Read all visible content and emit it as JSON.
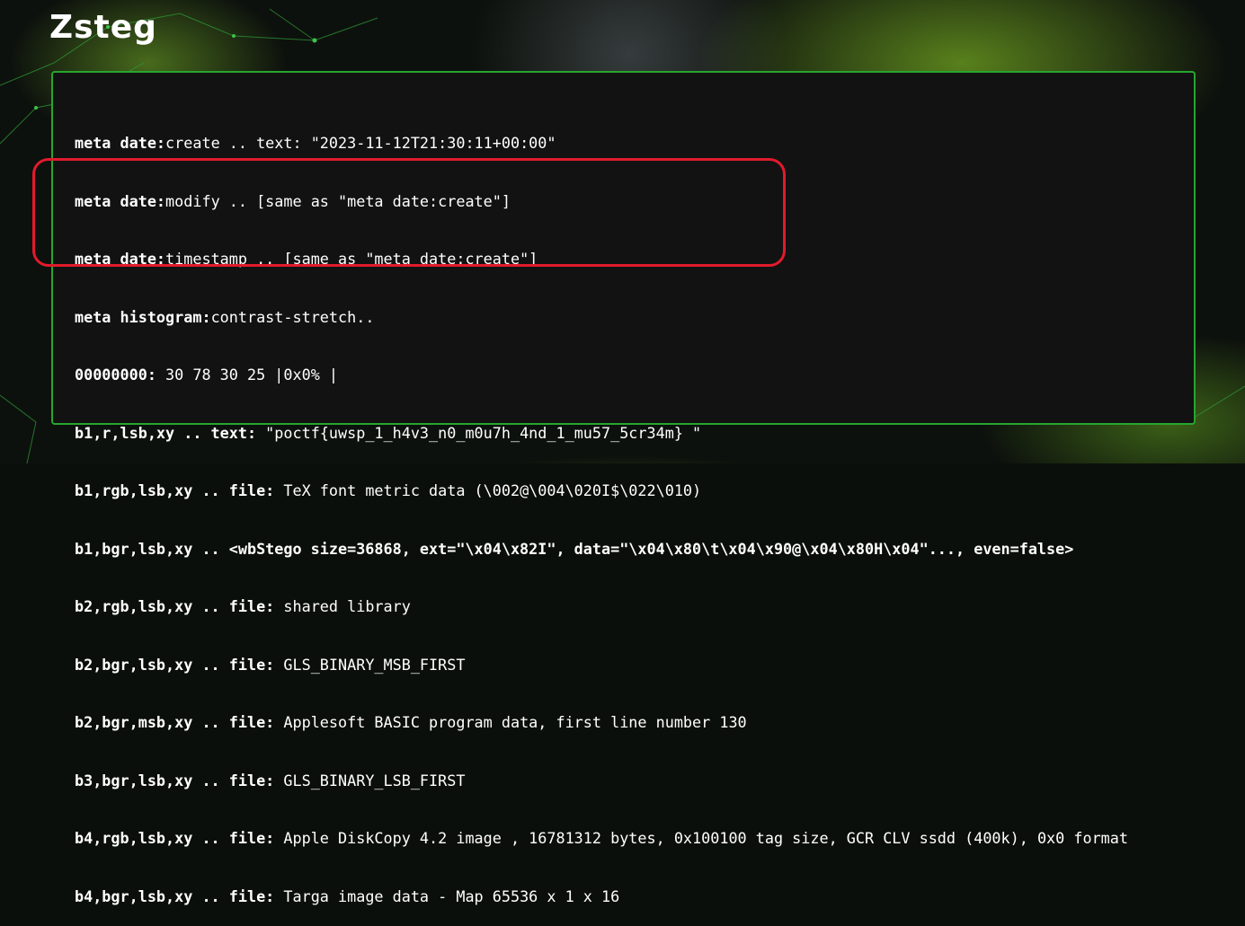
{
  "page": {
    "title": "Zsteg"
  },
  "colors": {
    "terminal_border": "#27a62f",
    "highlight": "#e11b2c",
    "terminal_bg": "#121212"
  },
  "output": [
    {
      "key": "meta date:",
      "value": "create .. text: \"2023-11-12T21:30:11+00:00\""
    },
    {
      "key": "meta date:",
      "value": "modify .. [same as \"meta date:create\"]"
    },
    {
      "key": "meta date:",
      "value": "timestamp .. [same as \"meta date:create\"]"
    },
    {
      "key": "meta histogram:",
      "value": "contrast-stretch.."
    },
    {
      "key": "00000000:",
      "value": " 30 78 30 25 |0x0% |"
    },
    {
      "key": "b1,r,lsb,xy .. text:",
      "value": " \"poctf{uwsp_1_h4v3_n0_m0u7h_4nd_1_mu57_5cr34m} \""
    },
    {
      "key": "b1,rgb,lsb,xy .. file:",
      "value": " TeX font metric data (\\002@\\004\\020I$\\022\\010)"
    },
    {
      "key": "b1,bgr,lsb,xy .. <wbStego size=36868, ext=\"\\x04\\x82I\", data=\"\\x04\\x80\\t\\x04\\x90@\\x04\\x80H\\x04\"..., even=false>",
      "value": ""
    },
    {
      "key": "b2,rgb,lsb,xy .. file:",
      "value": " shared library"
    },
    {
      "key": "b2,bgr,lsb,xy .. file:",
      "value": " GLS_BINARY_MSB_FIRST"
    },
    {
      "key": "b2,bgr,msb,xy .. file:",
      "value": " Applesoft BASIC program data, first line number 130"
    },
    {
      "key": "b3,bgr,lsb,xy .. file:",
      "value": " GLS_BINARY_LSB_FIRST"
    },
    {
      "key": "b4,rgb,lsb,xy .. file:",
      "value": " Apple DiskCopy 4.2 image , 16781312 bytes, 0x100100 tag size, GCR CLV ssdd (400k), 0x0 format"
    },
    {
      "key": "b4,bgr,lsb,xy .. file:",
      "value": " Targa image data - Map 65536 x 1 x 16"
    }
  ]
}
